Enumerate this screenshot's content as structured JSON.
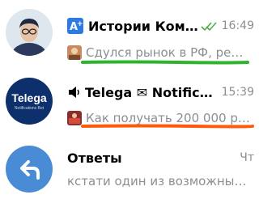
{
  "chats": [
    {
      "title": "Истории Ком…",
      "time": "16:49",
      "preview": "Сдулся рынок в РФ, ре…",
      "status": "read-double-check",
      "highlight_color": "#2db32d"
    },
    {
      "title_prefix_icon": "speaker-icon",
      "title": "Telega ✉ Notific…",
      "time": "15:39",
      "preview": "Как получать 200 000 р…",
      "avatar_text_main": "Telega",
      "avatar_text_sub": "Notifications Bot",
      "highlight_color": "#ff5a0a"
    },
    {
      "title": "Ответы",
      "time": "Чт",
      "preview": "кстати один из возможны…"
    }
  ],
  "colors": {
    "accent": "#4a8bd6",
    "check": "#4fae4e",
    "telega_bg": "#0d2f6b",
    "replies_bg": "#4a8bd6"
  }
}
